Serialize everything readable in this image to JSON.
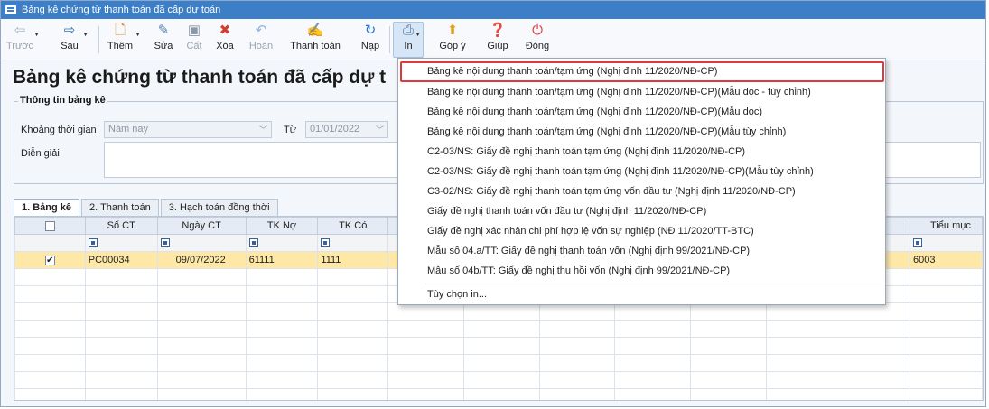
{
  "window": {
    "title": "Bảng kê chứng từ thanh toán đã cấp dự toán"
  },
  "toolbar": {
    "back": "Trước",
    "next": "Sau",
    "add": "Thêm",
    "edit": "Sửa",
    "save": "Cất",
    "delete": "Xóa",
    "undo": "Hoãn",
    "pay": "Thanh toán",
    "load": "Nạp",
    "print": "In",
    "feedback": "Góp ý",
    "help": "Giúp",
    "close": "Đóng"
  },
  "page_title": "Bảng kê chứng từ thanh toán đã cấp dự t",
  "info": {
    "group_title": "Thông tin bảng kê",
    "period_label": "Khoảng thời gian",
    "period_value": "Năm nay",
    "from_label": "Từ",
    "from_value": "01/01/2022",
    "desc_label": "Diễn giải"
  },
  "tabs": [
    "1. Bảng kê",
    "2. Thanh toán",
    "3. Hạch toán đồng thời"
  ],
  "grid": {
    "headers": [
      "",
      "Số CT",
      "Ngày CT",
      "TK Nợ",
      "TK Có",
      "",
      "",
      "",
      "",
      "",
      "",
      "Tiểu mục"
    ],
    "row": [
      "PC00034",
      "09/07/2022",
      "61111",
      "1111",
      "6003"
    ]
  },
  "print_menu": {
    "items": [
      "Bảng kê nội dung thanh toán/tạm ứng (Nghị định 11/2020/NĐ-CP)",
      "Bảng kê nội dung thanh toán/tạm ứng (Nghị định 11/2020/NĐ-CP)(Mẫu dọc - tùy chỉnh)",
      "Bảng kê nội dung thanh toán/tạm ứng (Nghị định 11/2020/NĐ-CP)(Mẫu dọc)",
      "Bảng kê nội dung thanh toán/tạm ứng (Nghị định 11/2020/NĐ-CP)(Mẫu tùy chỉnh)",
      "C2-03/NS: Giấy đề nghị thanh toán tạm ứng (Nghị định 11/2020/NĐ-CP)",
      "C2-03/NS: Giấy đề nghị thanh toán tạm ứng (Nghị định 11/2020/NĐ-CP)(Mẫu tùy chỉnh)",
      "C3-02/NS: Giấy đề nghị thanh toán tạm ứng vốn đầu tư (Nghị định 11/2020/NĐ-CP)",
      "Giấy đề nghị thanh toán vốn đầu tư (Nghị định 11/2020/NĐ-CP)",
      "Giấy đề nghị xác nhận chi phí hợp lệ vốn sự nghiệp (NĐ 11/2020/TT-BTC)",
      "Mẫu số 04.a/TT: Giấy đề nghị thanh toán vốn (Nghị định 99/2021/NĐ-CP)",
      "Mẫu số 04b/TT: Giấy đề nghị thu hồi vốn (Nghị định 99/2021/NĐ-CP)"
    ],
    "options": "Tùy chọn in..."
  },
  "colors": {
    "titlebar": "#3c7fc7",
    "highlight_border": "#e0393d",
    "selected_row": "#ffe8a6"
  }
}
